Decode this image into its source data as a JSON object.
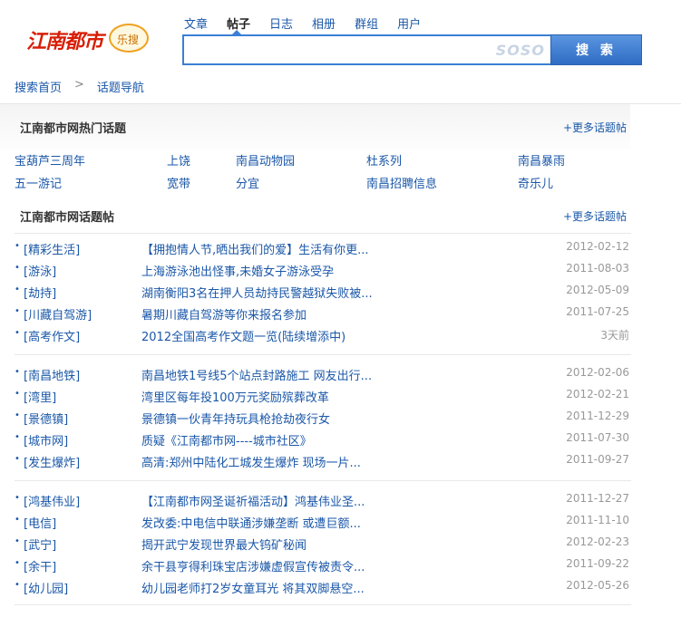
{
  "logo": {
    "text": "江南都市",
    "badge": "乐搜"
  },
  "search": {
    "tabs": [
      {
        "label": "文章",
        "active": false
      },
      {
        "label": "帖子",
        "active": true
      },
      {
        "label": "日志",
        "active": false
      },
      {
        "label": "相册",
        "active": false
      },
      {
        "label": "群组",
        "active": false
      },
      {
        "label": "用户",
        "active": false
      }
    ],
    "query": "",
    "engine_mark": "SOSO",
    "button_label": "搜 索"
  },
  "breadcrumb": {
    "home": "搜索首页",
    "separator": ">",
    "current": "话题导航"
  },
  "hot_topics": {
    "title": "江南都市网热门话题",
    "more": "+更多话题帖",
    "rows": [
      [
        "宝葫芦三周年",
        "上饶",
        "南昌动物园",
        "杜系列",
        "南昌暴雨"
      ],
      [
        "五一游记",
        "宽带",
        "分宜",
        "南昌招聘信息",
        "奇乐儿"
      ]
    ]
  },
  "topic_posts": {
    "title": "江南都市网话题帖",
    "more": "+更多话题帖",
    "groups": [
      [
        {
          "cat": "[精彩生活]",
          "title": "【拥抱情人节,晒出我们的爱】生活有你更...",
          "date": "2012-02-12"
        },
        {
          "cat": "[游泳]",
          "title": "上海游泳池出怪事,未婚女子游泳受孕",
          "date": "2011-08-03"
        },
        {
          "cat": "[劫持]",
          "title": "湖南衡阳3名在押人员劫持民警越狱失败被...",
          "date": "2012-05-09"
        },
        {
          "cat": "[川藏自驾游]",
          "title": "暑期川藏自驾游等你来报名参加",
          "date": "2011-07-25"
        },
        {
          "cat": "[高考作文]",
          "title": "2012全国高考作文题一览(陆续增添中)",
          "date": "3天前"
        }
      ],
      [
        {
          "cat": "[南昌地铁]",
          "title": "南昌地铁1号线5个站点封路施工 网友出行...",
          "date": "2012-02-06"
        },
        {
          "cat": "[湾里]",
          "title": "湾里区每年投100万元奖励殡葬改革",
          "date": "2012-02-21"
        },
        {
          "cat": "[景德镇]",
          "title": "景德镇一伙青年持玩具枪抢劫夜行女",
          "date": "2011-12-29"
        },
        {
          "cat": "[城市网]",
          "title": "质疑《江南都市网----城市社区》",
          "date": "2011-07-30"
        },
        {
          "cat": "[发生爆炸]",
          "title": "高清:郑州中陆化工城发生爆炸 现场一片...",
          "date": "2011-09-27"
        }
      ],
      [
        {
          "cat": "[鸿基伟业]",
          "title": "【江南都市网圣诞祈福活动】鸿基伟业圣...",
          "date": "2011-12-27"
        },
        {
          "cat": "[电信]",
          "title": "发改委:中电信中联通涉嫌垄断 或遭巨额...",
          "date": "2011-11-10"
        },
        {
          "cat": "[武宁]",
          "title": "揭开武宁发现世界最大钨矿秘闻",
          "date": "2012-02-23"
        },
        {
          "cat": "[余干]",
          "title": "余干县亨得利珠宝店涉嫌虚假宣传被责令...",
          "date": "2011-09-22"
        },
        {
          "cat": "[幼儿园]",
          "title": "幼儿园老师打2岁女童耳光 将其双脚悬空...",
          "date": "2012-05-26"
        }
      ]
    ]
  }
}
